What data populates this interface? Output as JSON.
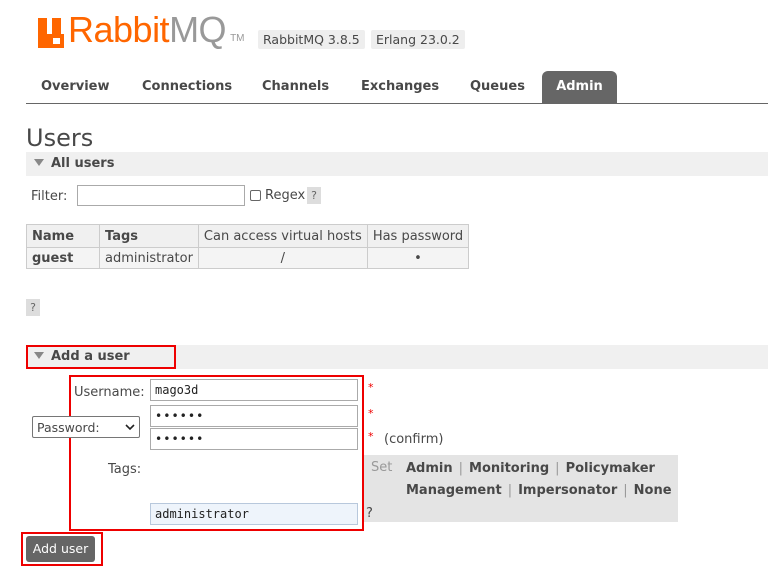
{
  "header": {
    "logo_brand": "Rabbit",
    "logo_suffix": "MQ",
    "logo_tm": "TM",
    "version": "RabbitMQ 3.8.5",
    "erlang": "Erlang 23.0.2"
  },
  "tabs": [
    "Overview",
    "Connections",
    "Channels",
    "Exchanges",
    "Queues",
    "Admin"
  ],
  "page_title": "Users",
  "all_users": {
    "section_title": "All users",
    "filter_label": "Filter:",
    "filter_value": "",
    "regex_label": "Regex",
    "help": "?",
    "table": {
      "headers": [
        "Name",
        "Tags",
        "Can access virtual hosts",
        "Has password"
      ],
      "rows": [
        {
          "name": "guest",
          "tags": "administrator",
          "vhosts": "/",
          "has_password": "•"
        }
      ]
    },
    "help2": "?"
  },
  "add_user": {
    "section_title": "Add a user",
    "username_label": "Username:",
    "username_value": "mago3d",
    "password_mode": "Password:",
    "password_value": "••••••",
    "password_confirm_value": "••••••",
    "required_mark": "*",
    "confirm_label": "(confirm)",
    "tags_label": "Tags:",
    "tags_value": "administrator",
    "set_label": "Set",
    "tag_options": [
      "Admin",
      "Monitoring",
      "Policymaker",
      "Management",
      "Impersonator",
      "None"
    ],
    "separator": "|",
    "help": "?",
    "submit_label": "Add user"
  }
}
